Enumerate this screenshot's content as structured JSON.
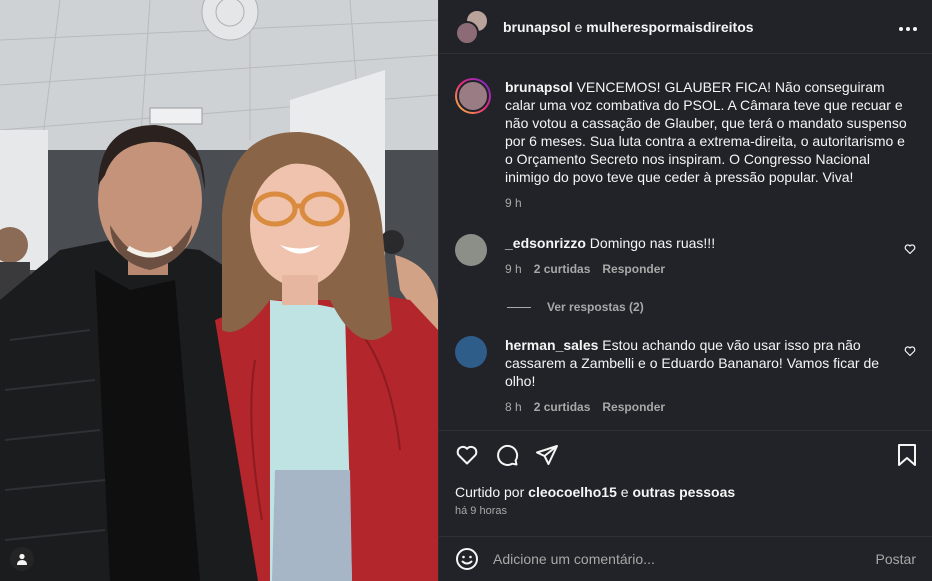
{
  "header": {
    "user1": "brunapsol",
    "conj": "e",
    "user2": "mulherespormaisdireitos"
  },
  "caption": {
    "username": "brunapsol",
    "text": "VENCEMOS! GLAUBER FICA! Não conseguiram calar uma voz combativa do PSOL. A Câmara teve que recuar e não votou a cassação de Glauber, que terá o mandato suspenso por 6 meses. Sua luta contra a extrema-direita, o autoritarismo e o Orçamento Secreto nos inspiram. O Congresso Nacional inimigo do povo teve que ceder à pressão popular. Viva!",
    "time": "9 h"
  },
  "comments": [
    {
      "username": "_edsonrizzo",
      "text": "Domingo nas ruas!!!",
      "time": "9 h",
      "likes": "2 curtidas",
      "reply": "Responder"
    },
    {
      "username": "herman_sales",
      "text": "Estou achando que vão usar isso pra não cassarem a Zambelli e o Eduardo Bananaro! Vamos ficar de olho!",
      "time": "8 h",
      "likes": "2 curtidas",
      "reply": "Responder"
    }
  ],
  "view_replies": "Ver respostas (2)",
  "likes_line": {
    "prefix": "Curtido por",
    "user": "cleocoelho15",
    "middle": "e",
    "suffix": "outras pessoas"
  },
  "post_time": "há 9 horas",
  "add_comment": {
    "placeholder": "Adicione um comentário...",
    "post_label": "Postar"
  },
  "icons": {
    "more": "more-horizontal-icon",
    "like": "heart-icon",
    "comment": "comment-bubble-icon",
    "share": "paper-plane-icon",
    "save": "bookmark-icon",
    "emoji": "smiley-icon",
    "tag": "person-tag-icon"
  },
  "colors": {
    "panel_bg": "#212328",
    "text": "#f5f5f5",
    "muted": "#a8a8a8",
    "story_ring": [
      "#f9ce34",
      "#ee2a7b",
      "#6228d7"
    ]
  }
}
